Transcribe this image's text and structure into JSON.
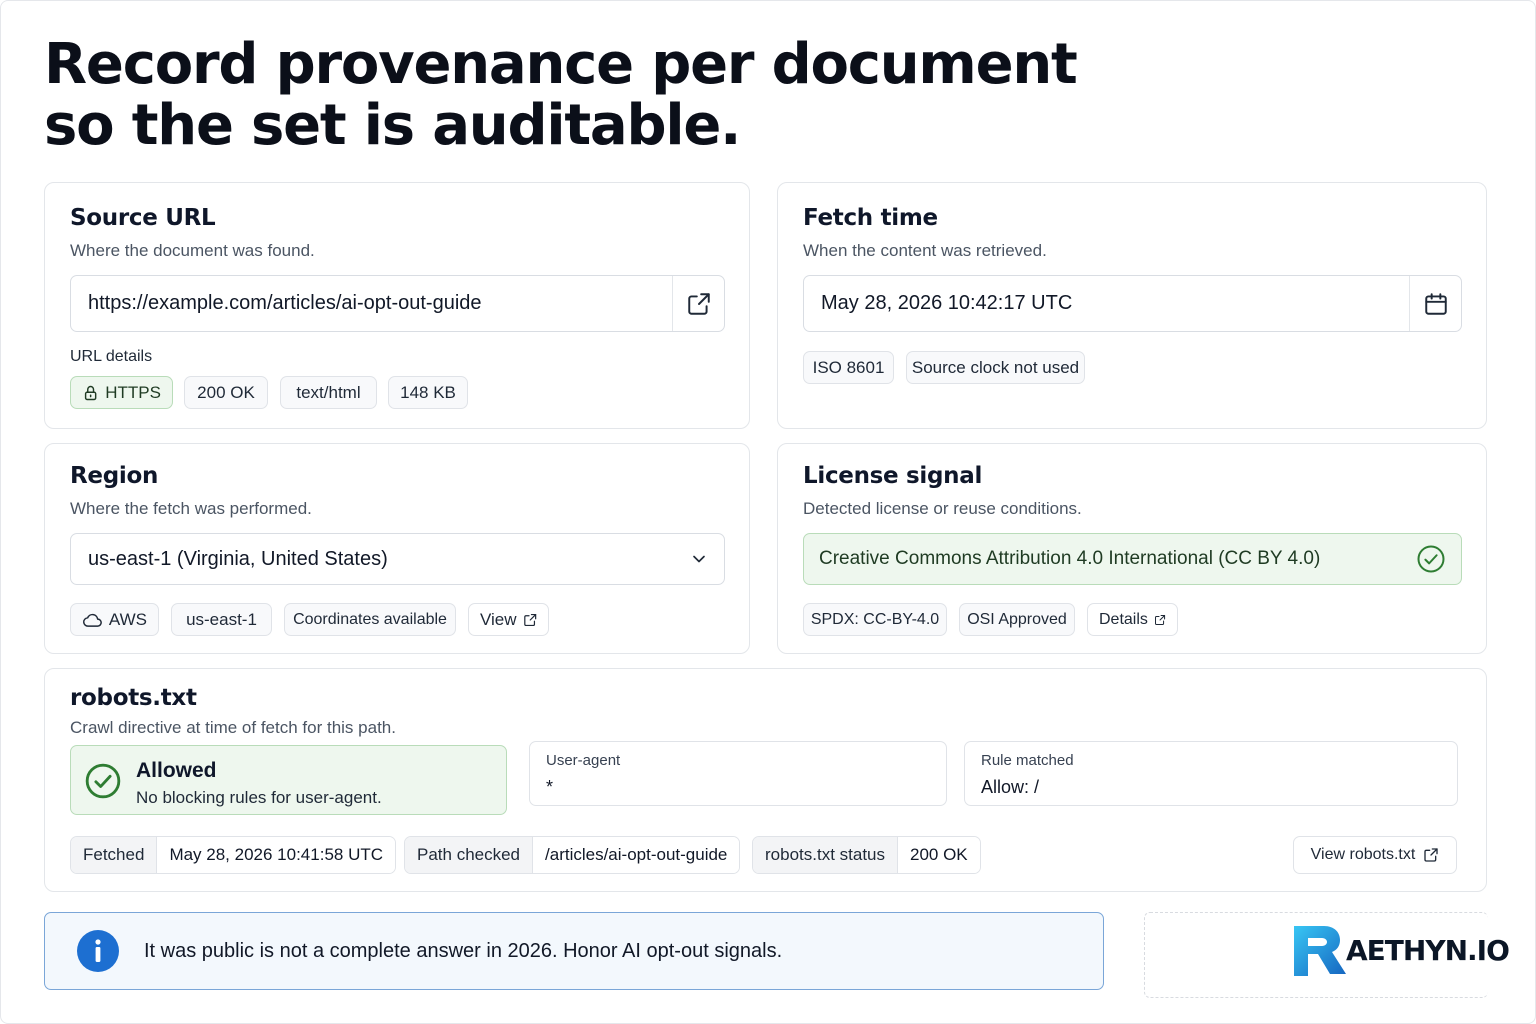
{
  "title": "Record provenance per document so the set is auditable.",
  "source_url": {
    "heading": "Source URL",
    "subtitle": "Where the document was found.",
    "url": "https://example.com/articles/ai-opt-out-guide",
    "details_label": "URL details",
    "chips": [
      "HTTPS",
      "200 OK",
      "text/html",
      "148 KB"
    ]
  },
  "fetch_time": {
    "heading": "Fetch time",
    "subtitle": "When the content was retrieved.",
    "value": "May 28, 2026 10:42:17 UTC",
    "chips": [
      "ISO 8601",
      "Source clock not used"
    ]
  },
  "region": {
    "heading": "Region",
    "subtitle": "Where the fetch was performed.",
    "selected": "us-east-1 (Virginia, United States)",
    "chips": [
      "AWS",
      "us-east-1",
      "Coordinates available"
    ],
    "view_label": "View"
  },
  "license": {
    "heading": "License signal",
    "subtitle": "Detected license or reuse conditions.",
    "value": "Creative Commons Attribution 4.0 International (CC BY 4.0)",
    "chips": [
      "SPDX: CC-BY-4.0",
      "OSI Approved"
    ],
    "details_label": "Details"
  },
  "robots": {
    "heading": "robots.txt",
    "subtitle": "Crawl directive at time of fetch for this path.",
    "status_title": "Allowed",
    "status_desc": "No blocking rules for user-agent.",
    "user_agent_label": "User-agent",
    "user_agent_value": "*",
    "rule_label": "Rule matched",
    "rule_value": "Allow: /",
    "fetched_label": "Fetched",
    "fetched_value": "May 28, 2026 10:41:58 UTC",
    "path_label": "Path checked",
    "path_value": "/articles/ai-opt-out-guide",
    "status_label": "robots.txt status",
    "status_value": "200 OK",
    "view_label": "View robots.txt"
  },
  "info": {
    "message": "It was public is not a complete answer in 2026. Honor AI opt-out signals."
  },
  "logo": {
    "text": "AETHYN.IO"
  },
  "colors": {
    "green_bg": "#eef7ee",
    "green_border": "#b9dcb9",
    "green_icon": "#2e7d32",
    "info_blue": "#1d6fd1"
  }
}
